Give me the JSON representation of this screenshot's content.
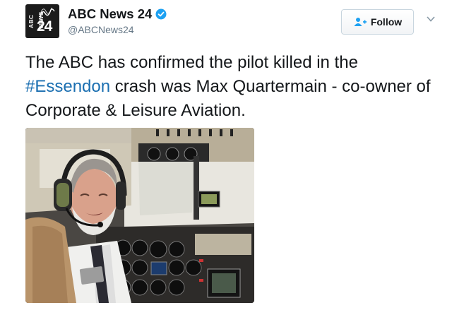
{
  "account": {
    "name": "ABC News 24",
    "handle": "@ABCNews24",
    "avatar_side_text": "ABC NEWS",
    "avatar_number": "24",
    "verified": true,
    "avatar_icon": "abc-news-logo"
  },
  "follow_button": {
    "label": "Follow",
    "icon": "add-user-icon"
  },
  "menu_icon": "chevron-down-icon",
  "tweet": {
    "text_before": "The ABC has confirmed the pilot killed in the ",
    "hashtag": "#Essendon",
    "text_after": " crash was Max Quartermain -  co-owner of Corporate & Leisure Aviation."
  },
  "photo": {
    "subject": "pilot-in-cockpit-photo"
  },
  "colors": {
    "hashtag": "#1b6fb1",
    "verified": "#1da1f2",
    "handle": "#657786",
    "text": "#14171a"
  }
}
